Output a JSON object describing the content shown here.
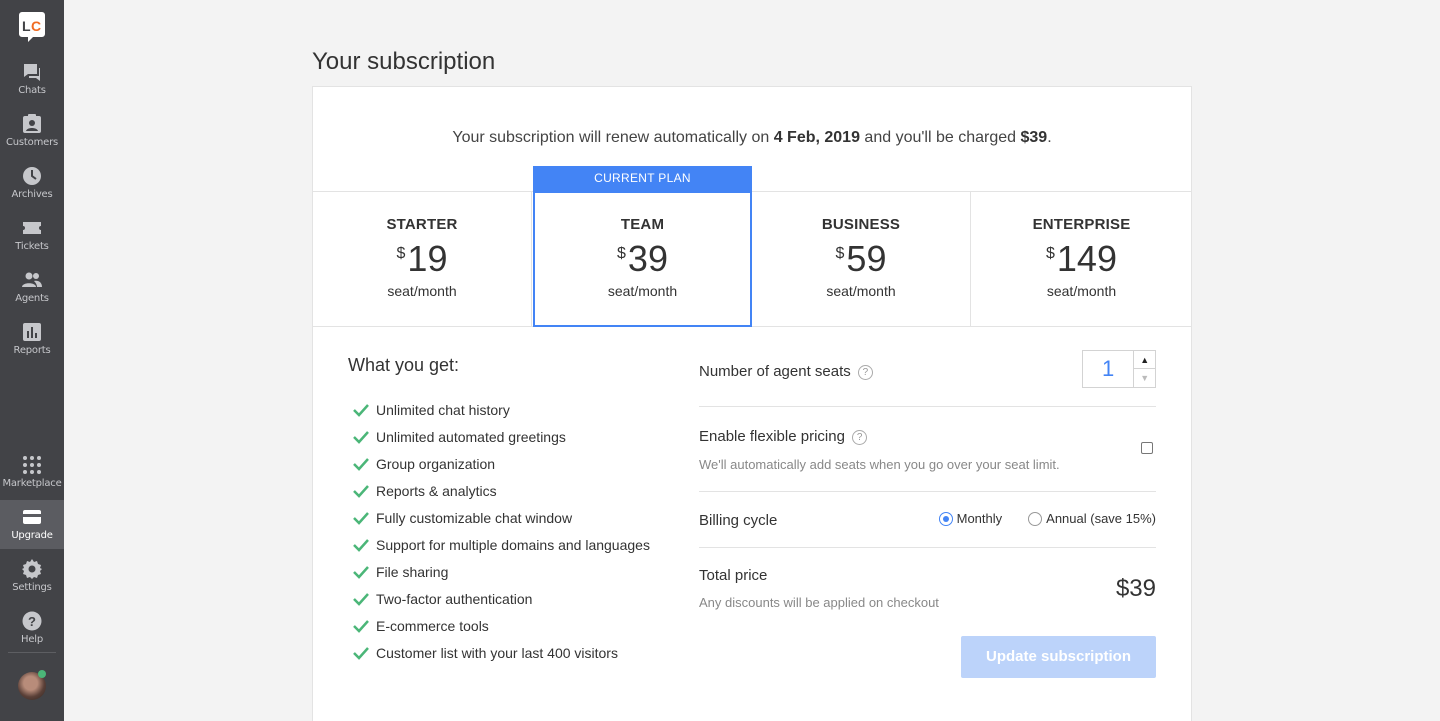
{
  "sidebar": {
    "logo_text": "LC",
    "items": [
      {
        "label": "Chats",
        "icon": "chat-icon"
      },
      {
        "label": "Customers",
        "icon": "customers-icon"
      },
      {
        "label": "Archives",
        "icon": "clock-icon"
      },
      {
        "label": "Tickets",
        "icon": "ticket-icon"
      },
      {
        "label": "Agents",
        "icon": "agents-icon"
      },
      {
        "label": "Reports",
        "icon": "reports-icon"
      },
      {
        "label": "Marketplace",
        "icon": "grid-icon"
      },
      {
        "label": "Upgrade",
        "icon": "card-icon",
        "active": true
      },
      {
        "label": "Settings",
        "icon": "gear-icon"
      },
      {
        "label": "Help",
        "icon": "help-icon"
      }
    ]
  },
  "page": {
    "title": "Your subscription",
    "renew_prefix": "Your subscription will renew automatically on ",
    "renew_date": "4 Feb, 2019",
    "renew_middle": " and you'll be charged ",
    "renew_amount": "$39",
    "renew_suffix": "."
  },
  "plans": {
    "current_tag": "CURRENT PLAN",
    "items": [
      {
        "name": "STARTER",
        "currency": "$",
        "amount": "19",
        "period": "seat/month"
      },
      {
        "name": "TEAM",
        "currency": "$",
        "amount": "39",
        "period": "seat/month",
        "current": true
      },
      {
        "name": "BUSINESS",
        "currency": "$",
        "amount": "59",
        "period": "seat/month"
      },
      {
        "name": "ENTERPRISE",
        "currency": "$",
        "amount": "149",
        "period": "seat/month"
      }
    ]
  },
  "features": {
    "title": "What you get:",
    "items": [
      "Unlimited chat history",
      "Unlimited automated greetings",
      "Group organization",
      "Reports & analytics",
      "Fully customizable chat window",
      "Support for multiple domains and languages",
      "File sharing",
      "Two-factor authentication",
      "E-commerce tools",
      "Customer list with your last 400 visitors"
    ]
  },
  "settings": {
    "seats_label": "Number of agent seats",
    "seats_value": "1",
    "help_glyph": "?",
    "flex_label": "Enable flexible pricing",
    "flex_sub": "We'll automatically add seats when you go over your seat limit.",
    "flex_checked": false,
    "billing_label": "Billing cycle",
    "billing_options": [
      "Monthly",
      "Annual (save 15%)"
    ],
    "billing_selected": "Monthly",
    "total_label": "Total price",
    "total_sub": "Any discounts will be applied on checkout",
    "total_value": "$39",
    "update_label": "Update subscription"
  },
  "colors": {
    "accent": "#4384f5",
    "sidebar": "#424347",
    "check": "#4bb678",
    "logo_orange": "#f06b22"
  }
}
